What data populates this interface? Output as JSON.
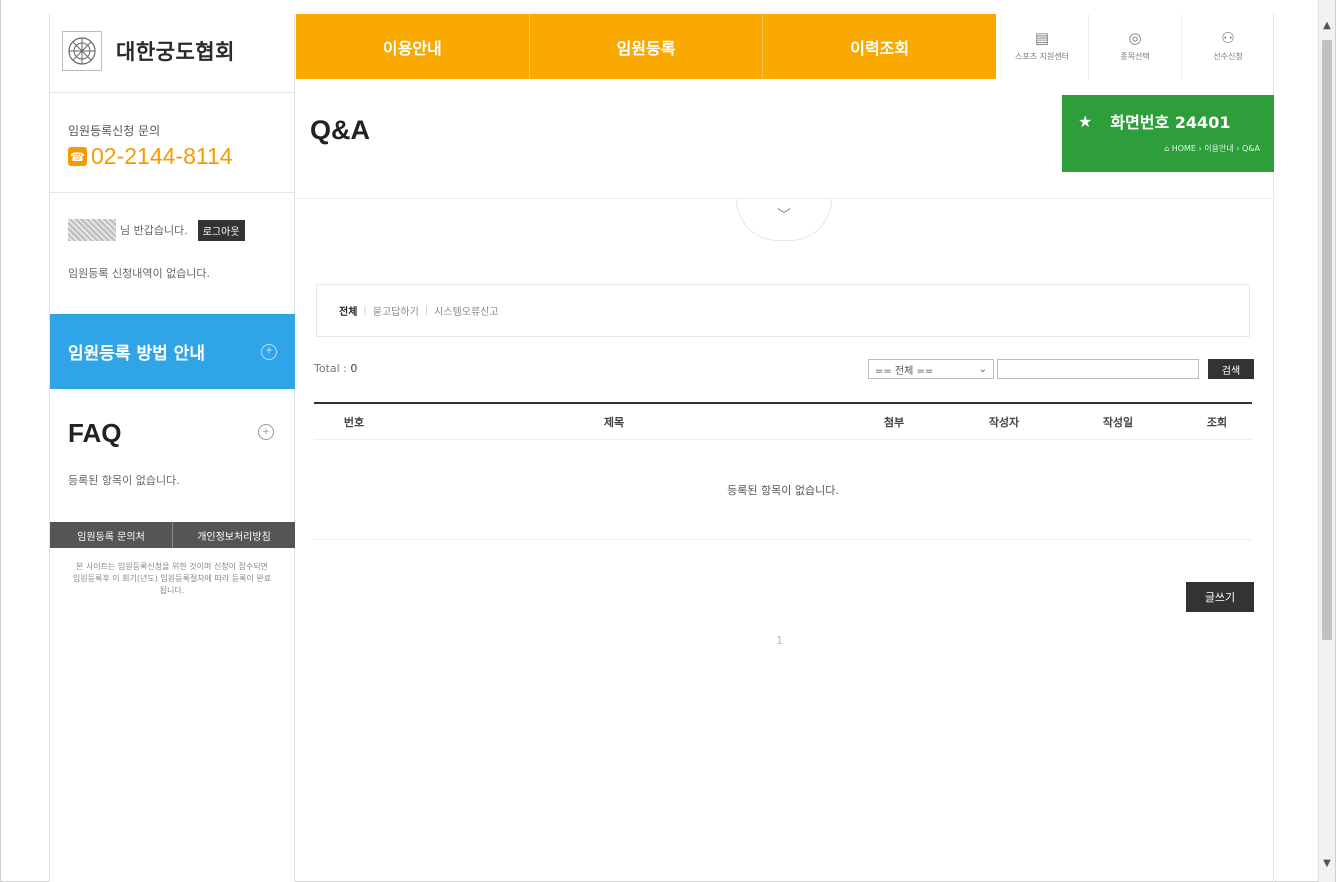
{
  "brand": {
    "name": "대한궁도협회"
  },
  "contact": {
    "label": "임원등록신청 문의",
    "phone": "02-2144-8114"
  },
  "user": {
    "greeting": "님 반갑습니다.",
    "logout_label": "로그아웃",
    "status": "임원등록 신청내역이 없습니다."
  },
  "guide": {
    "label": "임원등록 방법 안내"
  },
  "faq": {
    "title": "FAQ",
    "empty": "등록된 항목이 없습니다."
  },
  "footer_tabs": [
    "임원등록 문의처",
    "개인정보처리방침"
  ],
  "notice": "본 사이트는 임원등록신청을 위한 것이며 신청이 접수되면 임원등록후 이 회기(년도) 임원등록절차에 따라 등록이 완료됩니다.",
  "nav": {
    "items": [
      "이용안내",
      "임원등록",
      "이력조회"
    ]
  },
  "util": {
    "items": [
      {
        "label": "스포츠 지원센터",
        "icon": "document-icon"
      },
      {
        "label": "종목선택",
        "icon": "target-icon"
      },
      {
        "label": "선수신청",
        "icon": "person-icon"
      }
    ]
  },
  "page": {
    "title": "Q&A"
  },
  "screen": {
    "number_label": "화면번호 24401",
    "breadcrumb": "HOME › 이용안내 › Q&A"
  },
  "categories": {
    "items": [
      "전체",
      "묻고답하기",
      "시스템오류신고"
    ],
    "selected": "전체"
  },
  "total": {
    "label": "Total :",
    "count": "0"
  },
  "search": {
    "select_value": "== 전체 ==",
    "input_value": "",
    "button_label": "검색"
  },
  "table": {
    "columns": [
      "번호",
      "제목",
      "첨부",
      "작성자",
      "작성일",
      "조회"
    ],
    "empty": "등록된 항목이 없습니다."
  },
  "write_label": "글쓰기",
  "pager": {
    "current": "1"
  },
  "colors": {
    "nav": "#f9a900",
    "guide": "#2fa4e7",
    "screen": "#2e9e3a",
    "phone": "#f59b00"
  }
}
